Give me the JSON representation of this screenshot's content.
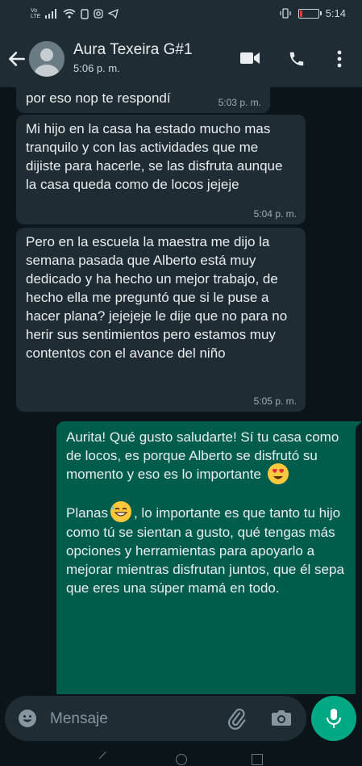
{
  "status_bar": {
    "carrier_top": "Vo",
    "carrier_bottom": "LTE",
    "time": "5:14",
    "battery_level": 0.12
  },
  "header": {
    "contact_name": "Aura Texeira G#1",
    "contact_status": "5:06 p. m."
  },
  "messages": [
    {
      "direction": "incoming",
      "text": "por eso nop te respondí",
      "time": "5:03 p. m."
    },
    {
      "direction": "incoming",
      "text": "Mi hijo en la casa ha estado mucho mas tranquilo y con las actividades que me dijiste para hacerle, se las disfruta aunque la casa queda como de locos jejeje",
      "time": "5:04 p. m."
    },
    {
      "direction": "incoming",
      "text": "Pero en la escuela la maestra me dijo la semana pasada que Alberto está muy dedicado y ha hecho un mejor trabajo, de hecho ella me preguntó que si le puse a hacer plana? jejejeje le dije que no para no herir sus sentimientos pero estamos muy contentos con el avance del niño",
      "time": "5:05 p. m."
    },
    {
      "direction": "outgoing",
      "paragraph1": "Aurita! Qué gusto saludarte! Sí tu casa como de locos, es porque Alberto se disfrutó su momento y eso es lo importante",
      "paragraph1_emoji": "heart-eyes-emoji",
      "paragraph2_before": "Planas",
      "paragraph2_emoji": "grinning-sweat-emoji",
      "paragraph2_after": ", lo importante es que tanto tu hijo como tú se sientan a gusto, qué tengas más opciones y herramientas para apoyarlo a mejorar mientras disfrutan juntos, que él sepa que eres una súper mamá en todo."
    }
  ],
  "input": {
    "placeholder": "Mensaje",
    "value": ""
  },
  "icons": {
    "back": "arrow-left-icon",
    "video": "video-call-icon",
    "call": "phone-icon",
    "menu": "more-vert-icon",
    "emoji": "smiley-icon",
    "attach": "paperclip-icon",
    "camera": "camera-icon",
    "mic": "microphone-icon"
  },
  "colors": {
    "background": "#0b1418",
    "header": "#1f2c33",
    "incoming_bubble": "#1f2c33",
    "outgoing_bubble": "#005c4b",
    "accent": "#00a884"
  }
}
